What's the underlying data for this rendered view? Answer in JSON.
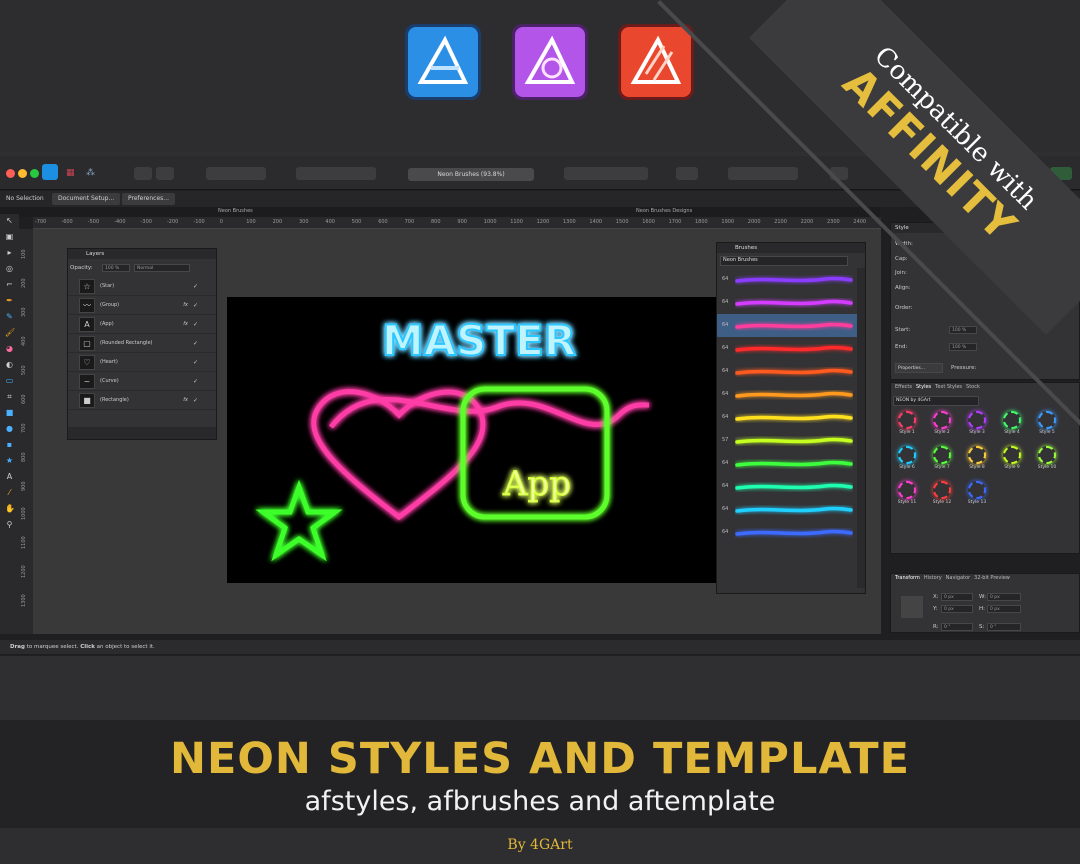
{
  "corner_banner": {
    "line1": "Compatible with",
    "line2": "AFFINITY"
  },
  "app_logos": [
    {
      "name": "affinity-designer-logo",
      "color": "#1d8fe0"
    },
    {
      "name": "affinity-photo-logo",
      "color": "#b14ee6"
    },
    {
      "name": "affinity-publisher-logo",
      "color": "#e8452f"
    }
  ],
  "window": {
    "doc_title": "Neon Brushes (93.8%)"
  },
  "context_bar": {
    "selection": "No Selection",
    "doc_setup": "Document Setup...",
    "preferences": "Preferences..."
  },
  "tabs": {
    "left": "Neon Brushes",
    "right": "Neon Brushes Designs"
  },
  "ruler_top": [
    "-700",
    "-600",
    "-500",
    "-400",
    "-300",
    "-200",
    "-100",
    "0",
    "100",
    "200",
    "300",
    "400",
    "500",
    "600",
    "700",
    "800",
    "900",
    "1000",
    "1100",
    "1200",
    "1300",
    "1400",
    "1500",
    "1600",
    "1700",
    "1800",
    "1900",
    "2000",
    "2100",
    "2200",
    "2300",
    "2400"
  ],
  "ruler_left": [
    "100",
    "200",
    "300",
    "400",
    "500",
    "600",
    "700",
    "800",
    "900",
    "1000",
    "1100",
    "1200",
    "1300"
  ],
  "layers": {
    "title": "Layers",
    "opacity_label": "Opacity:",
    "opacity_value": "100 %",
    "blend": "Normal",
    "rows": [
      {
        "name": "(Star)",
        "thumb": "☆",
        "fx": ""
      },
      {
        "name": "(Group)",
        "thumb": "〰",
        "fx": "fx"
      },
      {
        "name": "(App)",
        "thumb": "A",
        "fx": "fx"
      },
      {
        "name": "(Rounded Rectangle)",
        "thumb": "▢",
        "fx": ""
      },
      {
        "name": "(Heart)",
        "thumb": "♡",
        "fx": ""
      },
      {
        "name": "(Curve)",
        "thumb": "~",
        "fx": ""
      },
      {
        "name": "(Rectangle)",
        "thumb": "■",
        "fx": "fx"
      }
    ]
  },
  "brushes": {
    "title": "Brushes",
    "category": "Neon Brushes",
    "rows": [
      {
        "num": "64",
        "color": "#8b3dff"
      },
      {
        "num": "64",
        "color": "#d43dff"
      },
      {
        "num": "64",
        "color": "#ff3d9d"
      },
      {
        "num": "64",
        "color": "#ff2a2a"
      },
      {
        "num": "64",
        "color": "#ff5a1f"
      },
      {
        "num": "64",
        "color": "#ff9a1f"
      },
      {
        "num": "64",
        "color": "#ffe01f"
      },
      {
        "num": "57",
        "color": "#c4ff1f"
      },
      {
        "num": "64",
        "color": "#3dff3d"
      },
      {
        "num": "64",
        "color": "#1fffb0"
      },
      {
        "num": "64",
        "color": "#1fd0ff"
      },
      {
        "num": "64",
        "color": "#3d6bff"
      }
    ]
  },
  "stroke": {
    "title": "Style",
    "width": "Width:",
    "cap": "Cap:",
    "join": "Join:",
    "align": "Align:",
    "order": "Order:",
    "start": "Start:",
    "end": "End:",
    "start_val": "100 %",
    "end_val": "100 %",
    "properties": "Properties...",
    "pressure": "Pressure:"
  },
  "styles": {
    "tabs": [
      "Effects",
      "Styles",
      "Text Styles",
      "Stock"
    ],
    "category": "NEON by 4GArt",
    "items": [
      {
        "label": "Style 1",
        "color": "#ff3d6b"
      },
      {
        "label": "Style 2",
        "color": "#ff3dd0"
      },
      {
        "label": "Style 3",
        "color": "#b43dff"
      },
      {
        "label": "Style 4",
        "color": "#3dff6b"
      },
      {
        "label": "Style 5",
        "color": "#3d9dff"
      },
      {
        "label": "Style 6",
        "color": "#1fd0ff"
      },
      {
        "label": "Style 7",
        "color": "#5aff3d"
      },
      {
        "label": "Style 8",
        "color": "#ffd03d"
      },
      {
        "label": "Style 9",
        "color": "#c4ff1f"
      },
      {
        "label": "Style 10",
        "color": "#9dff3d"
      },
      {
        "label": "Style 11",
        "color": "#ff3dd0"
      },
      {
        "label": "Style 12",
        "color": "#ff3d3d"
      },
      {
        "label": "Style 13",
        "color": "#3d6bff"
      }
    ]
  },
  "transform": {
    "tabs": [
      "Transform",
      "History",
      "Navigator",
      "32-bit Preview"
    ],
    "x": "X:",
    "y": "Y:",
    "w": "W:",
    "h": "H:",
    "r": "R:",
    "s": "S:",
    "x_val": "0 px",
    "y_val": "0 px",
    "w_val": "0 px",
    "h_val": "0 px",
    "r_val": "0 °",
    "s_val": "0 °"
  },
  "artboard": {
    "title": "MASTER",
    "app": "App"
  },
  "status": {
    "drag": "Drag",
    "drag_rest": " to marquee select. ",
    "click": "Click",
    "click_rest": " an object to select it."
  },
  "bottom": {
    "headline": "NEON STYLES AND TEMPLATE",
    "subline": "afstyles, afbrushes and aftemplate",
    "credit": "By 4GArt"
  }
}
